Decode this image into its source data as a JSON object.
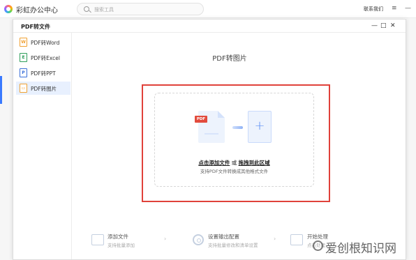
{
  "app": {
    "title": "彩虹办公中心",
    "search_placeholder": "搜索工具",
    "contact": "联系我们",
    "controls": {
      "menu": "≡",
      "minimize": "—"
    }
  },
  "dialog": {
    "title": "PDF转文件",
    "controls": {
      "minimize": "—",
      "maximize": "□",
      "close": "✕"
    }
  },
  "sidebar": {
    "items": [
      {
        "label": "PDF转Word",
        "icon": "word-icon",
        "glyph": "W",
        "color": "#f0a030",
        "active": false
      },
      {
        "label": "PDF转Excel",
        "icon": "excel-icon",
        "glyph": "E",
        "color": "#2e9e5a",
        "active": false
      },
      {
        "label": "PDF转PPT",
        "icon": "ppt-icon",
        "glyph": "P",
        "color": "#3a6fd8",
        "active": false
      },
      {
        "label": "PDF转图片",
        "icon": "image-icon",
        "glyph": "▭",
        "color": "#f0a030",
        "active": true
      }
    ]
  },
  "main": {
    "title": "PDF转图片",
    "pdf_badge": "PDF",
    "plus": "+",
    "drop": {
      "add_link": "点击添加文件",
      "or": " 或 ",
      "drag_link": "拖拽到此区域",
      "hint": "支持PDF文件转换成其他格式文件"
    }
  },
  "steps": [
    {
      "title": "添加文件",
      "desc": "支持批量添加",
      "icon": "add-folder-icon"
    },
    {
      "title": "设置输出配置",
      "desc": "支持批量修改和清单设置",
      "icon": "settings-icon"
    },
    {
      "title": "开始处理",
      "desc": "点击处理",
      "icon": "start-process-icon"
    }
  ],
  "step_separator": "›",
  "watermark": "爱创根知识网",
  "colors": {
    "accent": "#3a7afe",
    "highlight": "#e0413a",
    "pdf_badge": "#e24b3d",
    "active_bg": "#e8f0fe"
  }
}
